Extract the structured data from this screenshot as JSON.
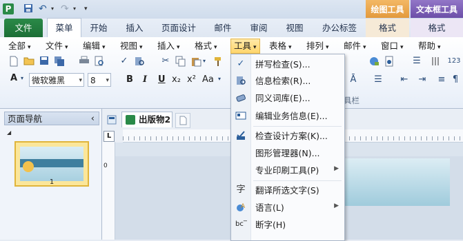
{
  "titlebar": {
    "app_icon": "P",
    "qat_undo": "↶",
    "qat_redo": "↷",
    "qat_more": "▾",
    "contextual_tabs": [
      {
        "label": "绘图工具",
        "color": "#e6a34a"
      },
      {
        "label": "文本框工具",
        "color": "#7b5bb3"
      }
    ]
  },
  "ribbon_tabs": {
    "file": "文件",
    "items": [
      "菜单",
      "开始",
      "插入",
      "页面设计",
      "邮件",
      "审阅",
      "视图",
      "办公标签"
    ],
    "context_sub": [
      "格式",
      "格式"
    ]
  },
  "menubar": {
    "items": [
      "全部",
      "文件",
      "编辑",
      "视图",
      "插入",
      "格式",
      "工具",
      "表格",
      "排列",
      "邮件",
      "窗口",
      "帮助"
    ],
    "open_item": "工具"
  },
  "toolbar": {
    "font_name": "微软雅黑",
    "font_size": "8",
    "bold": "B",
    "italic": "I",
    "underline": "U",
    "subscript": "x₂",
    "superscript": "x²",
    "case": "Aa",
    "group_label": "具栏"
  },
  "navpane": {
    "title": "页面导航",
    "collapse": "‹",
    "section_toggle": "◢",
    "page_number": "1"
  },
  "document": {
    "tab_label": "出版物2",
    "tab_close": "✕",
    "ruler_corner": "L",
    "ruler_v_zero": "0"
  },
  "dropdown": {
    "items": [
      {
        "label": "拼写检查(S)...",
        "icon": "spellcheck-icon"
      },
      {
        "label": "信息检索(R)...",
        "icon": "research-icon"
      },
      {
        "label": "同义词库(E)...",
        "icon": "thesaurus-icon"
      },
      {
        "label": "编辑业务信息(E)...",
        "icon": "business-info-icon"
      },
      {
        "label": "检查设计方案(K)...",
        "icon": "design-checker-icon"
      },
      {
        "label": "图形管理器(N)...",
        "icon": ""
      },
      {
        "label": "专业印刷工具(P)",
        "icon": "",
        "submenu": true
      },
      {
        "label": "翻译所选文字(S)",
        "icon": "translate-icon"
      },
      {
        "label": "语言(L)",
        "icon": "language-icon",
        "submenu": true
      },
      {
        "label": "断字(H)",
        "icon": "hyphenation-icon"
      }
    ]
  }
}
